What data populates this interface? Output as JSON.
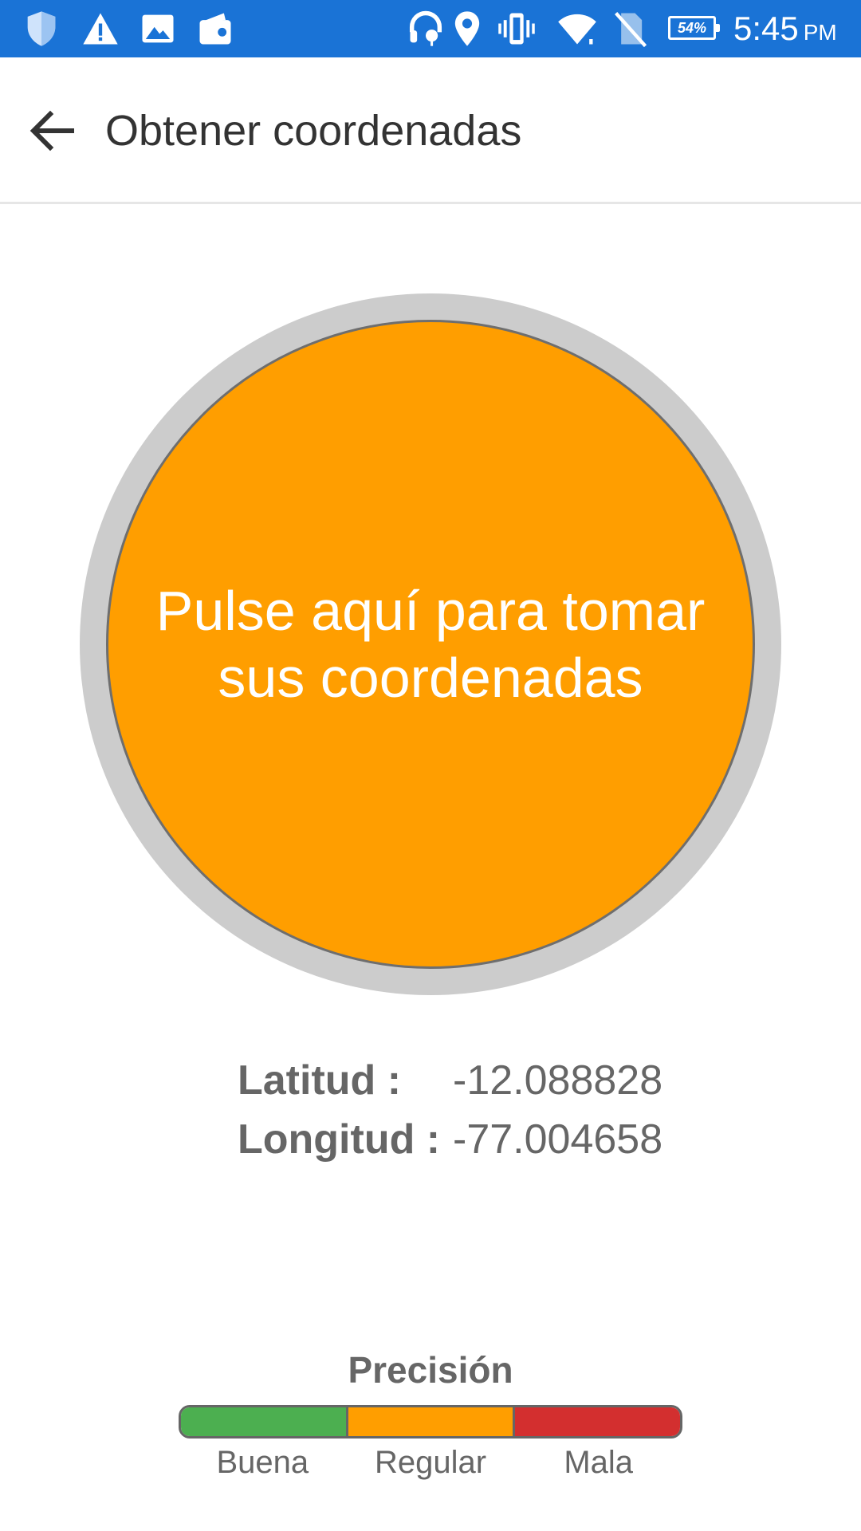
{
  "status_bar": {
    "battery_percent": "54%",
    "time": "5:45",
    "ampm": "PM",
    "background_color": "#1a73d6",
    "icons": [
      "shield-icon",
      "warning-icon",
      "image-icon",
      "wallet-icon",
      "headset-icon",
      "location-icon",
      "vibrate-icon",
      "wifi-icon",
      "no-sim-icon",
      "battery-icon"
    ]
  },
  "app_bar": {
    "title": "Obtener coordenadas",
    "back_icon": "arrow-left-icon"
  },
  "capture": {
    "label": "Pulse aquí para tomar sus coordenadas",
    "button_color": "#ff9e00",
    "ring_color": "#cccccc"
  },
  "coordinates": {
    "latitude_label": "Latitud :",
    "latitude_value": "-12.088828",
    "longitude_label": "Longitud :",
    "longitude_value": "-77.004658"
  },
  "precision": {
    "title": "Precisión",
    "levels": [
      {
        "label": "Buena",
        "color": "#4caf50"
      },
      {
        "label": "Regular",
        "color": "#ff9e00"
      },
      {
        "label": "Mala",
        "color": "#d32f2f"
      }
    ]
  }
}
